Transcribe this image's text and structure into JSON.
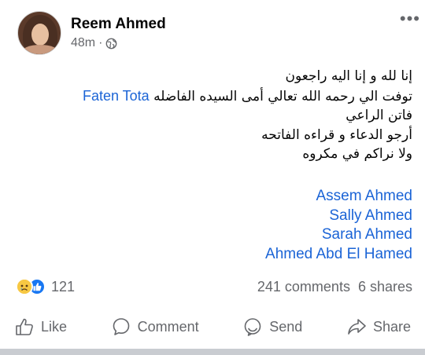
{
  "post": {
    "author": "Reem Ahmed",
    "time": "48m",
    "separator": "·",
    "privacy_icon": "globe-icon",
    "more_icon": "more-horizontal-icon",
    "body_lines": [
      "إنا لله و إنا اليه راجعون",
      "توفت الي رحمه الله تعالي أمى  السيده الفاضله",
      "فاتن الراعي",
      "أرجو الدعاء و قراءه الفاتحه",
      "ولا نراكم في مكروه"
    ],
    "mention": "Faten Tota",
    "tags": [
      "Assem Ahmed",
      "Sally Ahmed",
      "Sarah Ahmed",
      "Ahmed Abd El Hamed"
    ]
  },
  "stats": {
    "reaction_icons": [
      "sad-icon",
      "like-icon"
    ],
    "reactions_count": "121",
    "comments": "241 comments",
    "shares": "6 shares"
  },
  "actions": {
    "like": "Like",
    "comment": "Comment",
    "send": "Send",
    "share": "Share"
  },
  "colors": {
    "link": "#1b64d6",
    "secondary_text": "#65676b",
    "like_blue": "#1877f2",
    "sad_yellow": "#f7c843"
  }
}
